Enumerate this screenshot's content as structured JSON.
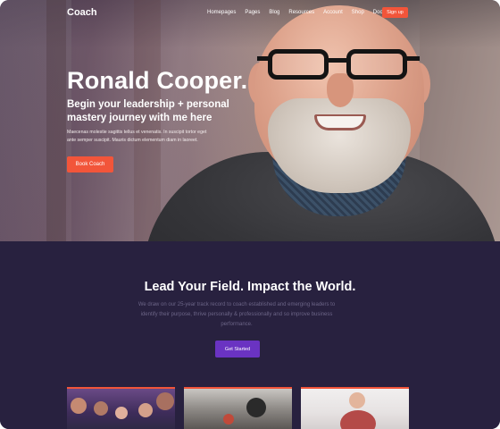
{
  "nav": {
    "logo": "Coach",
    "items": [
      {
        "label": "Homepages"
      },
      {
        "label": "Pages"
      },
      {
        "label": "Blog"
      },
      {
        "label": "Resources"
      },
      {
        "label": "Account"
      },
      {
        "label": "Shop"
      },
      {
        "label": "Docs"
      }
    ],
    "signup_label": "Sign up"
  },
  "hero": {
    "name": "Ronald Cooper.",
    "subtitle": "Begin your leadership + personal mastery journey with me here",
    "body": "Maecenas molestie sagittis tellus et venenatis. In suscipit tortor eget ante semper suscipit. Mauris dictum elementum diam in laoreet.",
    "cta": "Book Coach"
  },
  "section": {
    "title": "Lead Your Field. Impact the World.",
    "body": "We draw on our 25-year track record to coach established and emerging leaders to identify their purpose, thrive personally & professionally and so improve business performance.",
    "cta": "Get Started"
  },
  "colors": {
    "accent": "#f2553a",
    "primary_button": "#6a33c2",
    "dark_background": "#28213f"
  }
}
